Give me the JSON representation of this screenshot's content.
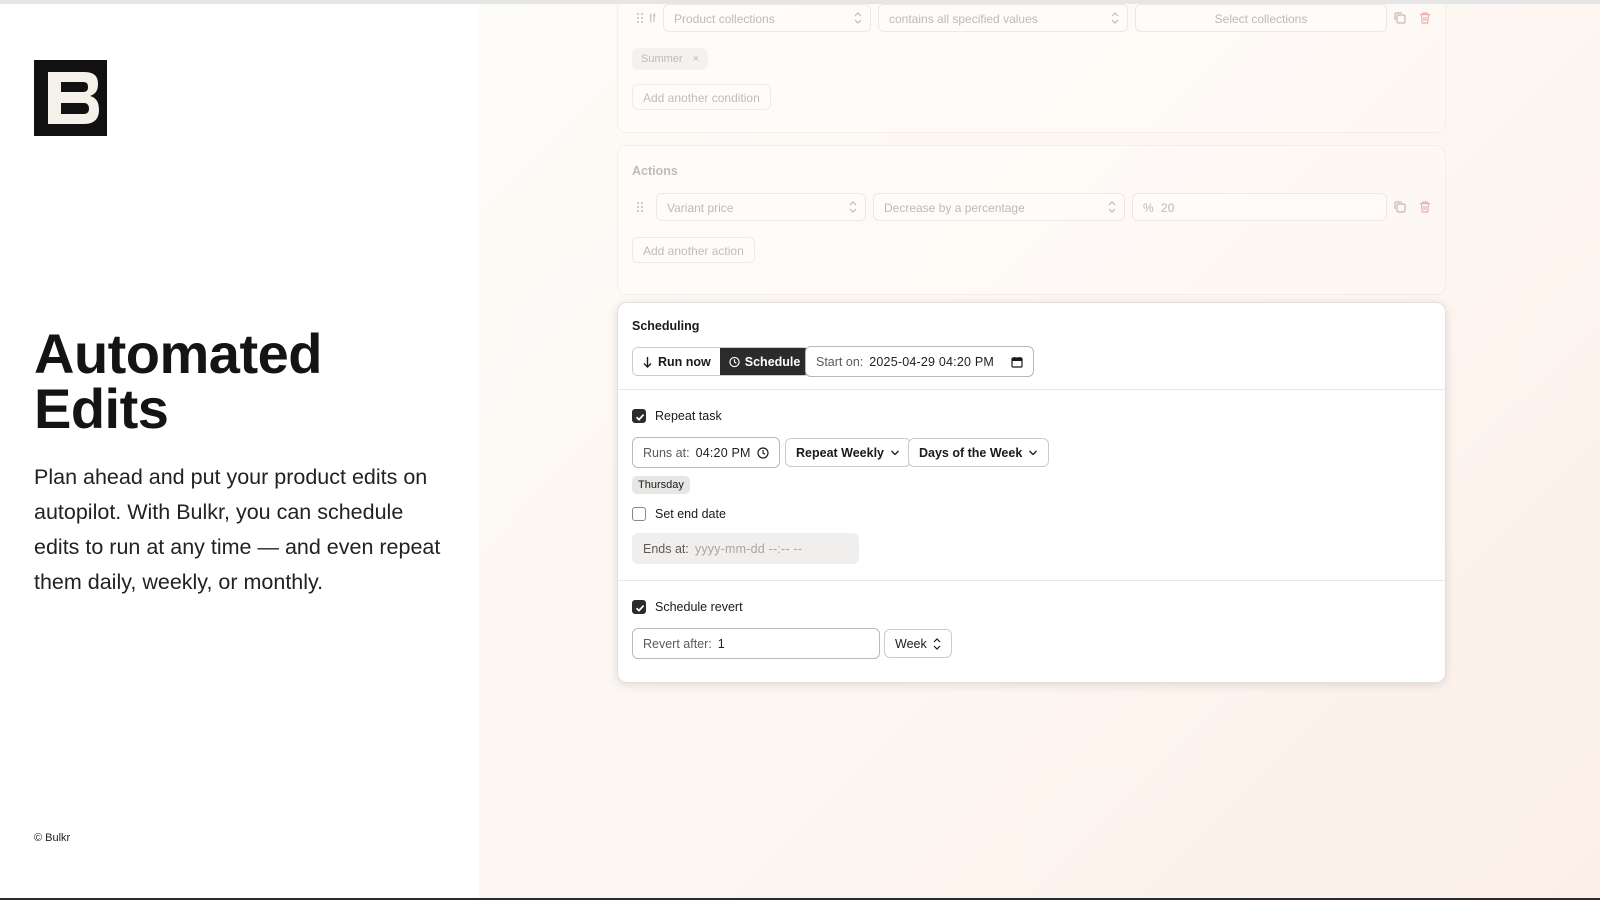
{
  "brand": {
    "logo_icon": "bulkr-b-logo",
    "copyright": "© Bulkr"
  },
  "hero": {
    "title": "Automated Edits",
    "description": "Plan ahead and put your product edits on autopilot. With Bulkr, you can schedule edits to run at any time — and even repeat them daily, weekly, or monthly."
  },
  "conditions": {
    "if_label": "If",
    "field": "Product collections",
    "operator": "contains all specified values",
    "value_placeholder": "Select collections",
    "chips": [
      "Summer"
    ],
    "add_button": "Add another condition"
  },
  "actions": {
    "title": "Actions",
    "field": "Variant price",
    "operation": "Decrease by a percentage",
    "value_prefix": "%",
    "value": "20",
    "add_button": "Add another action"
  },
  "scheduling": {
    "title": "Scheduling",
    "run_now_label": "Run now",
    "schedule_label": "Schedule",
    "mode": "Schedule",
    "start_label": "Start on:",
    "start_value": "2025-04-29 04:20 PM",
    "repeat_task_label": "Repeat task",
    "repeat_task_checked": true,
    "runs_at_label": "Runs at:",
    "runs_at_value": "04:20 PM",
    "repeat_option": "Repeat Weekly",
    "days_option": "Days of the Week",
    "selected_days": [
      "Thursday"
    ],
    "set_end_date_label": "Set end date",
    "set_end_date_checked": false,
    "ends_at_label": "Ends at:",
    "ends_at_placeholder": "yyyy-mm-dd --:-- --",
    "schedule_revert_label": "Schedule revert",
    "schedule_revert_checked": true,
    "revert_after_label": "Revert after:",
    "revert_after_value": "1",
    "revert_unit": "Week"
  },
  "colors": {
    "accent_dark": "#2b2b2b",
    "delete_red": "#e0706f"
  }
}
